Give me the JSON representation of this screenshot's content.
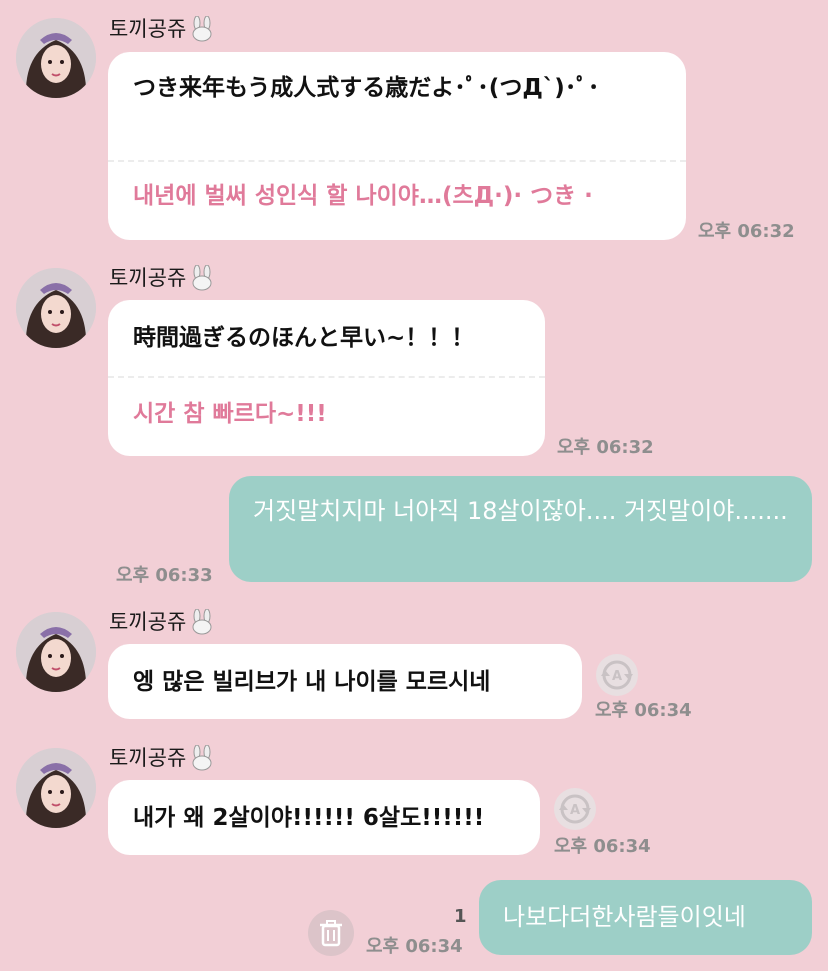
{
  "messages": [
    {
      "sender": "토끼공쥬",
      "original": "つき来年もう成人式する歳だよ･ﾟ･(つД`)･ﾟ･",
      "translation": "내년에 벌써 성인식 할 나이야…(츠Д·)· つき ·",
      "time": "오후 06:32"
    },
    {
      "sender": "토끼공쥬",
      "original": "時間過ぎるのほんと早い~！！！",
      "translation": "시간 참 빠르다~!!!",
      "time": "오후 06:32"
    },
    {
      "from_me": true,
      "text": "거짓말치지마 너아직 18살이잖아.... 거짓말이야.......",
      "time": "오후 06:33"
    },
    {
      "sender": "토끼공쥬",
      "original": "엥 많은 빌리브가 내 나이를 모르시네",
      "time": "오후 06:34",
      "icon": "translate-icon"
    },
    {
      "sender": "토끼공쥬",
      "original": "내가 왜 2살이야!!!!!! 6살도!!!!!!",
      "time": "오후 06:34",
      "icon": "translate-icon"
    },
    {
      "from_me": true,
      "text": "나보다더한사람들이잇네",
      "time": "오후 06:34",
      "unread_count": "1",
      "icon": "trash-icon"
    }
  ],
  "colors": {
    "background": "#f2cfd6",
    "bubble_theirs": "#ffffff",
    "bubble_mine": "#9dcfc7",
    "translation_text": "#e07a9a",
    "timestamp": "#8e8e8e"
  }
}
